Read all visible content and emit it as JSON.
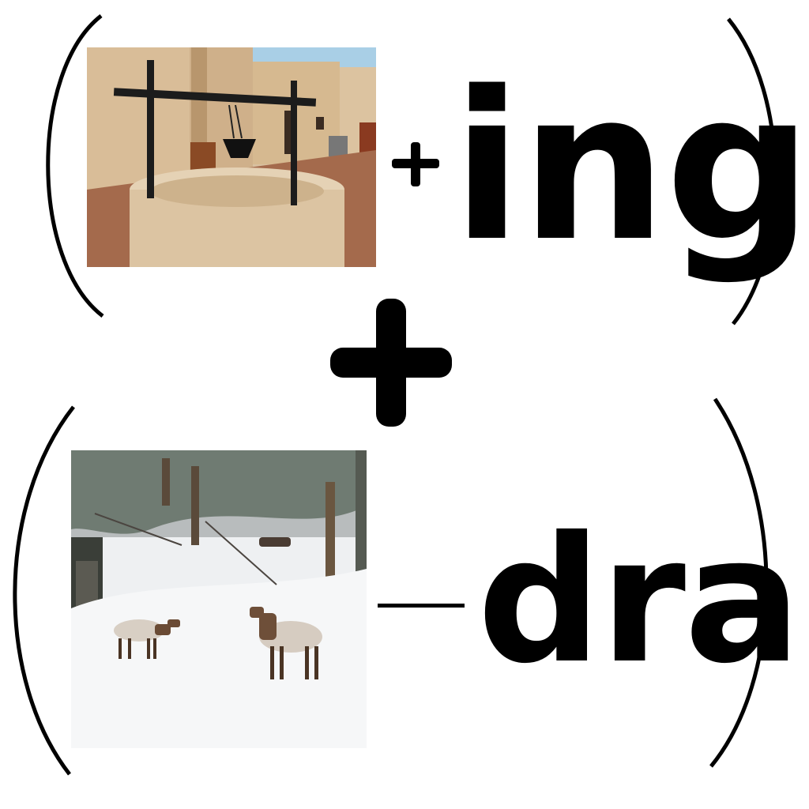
{
  "puzzle": {
    "top": {
      "picture": "well",
      "operator": "+",
      "suffix": "ing"
    },
    "join_operator": "+",
    "bottom": {
      "picture": "elk-in-snowy-forest",
      "operator": "minus",
      "suffix": "dra"
    }
  },
  "icons": [
    "left-parenthesis",
    "right-parenthesis",
    "plus-icon",
    "minus-icon"
  ],
  "colors": {
    "ink": "#000000",
    "background": "#ffffff"
  }
}
